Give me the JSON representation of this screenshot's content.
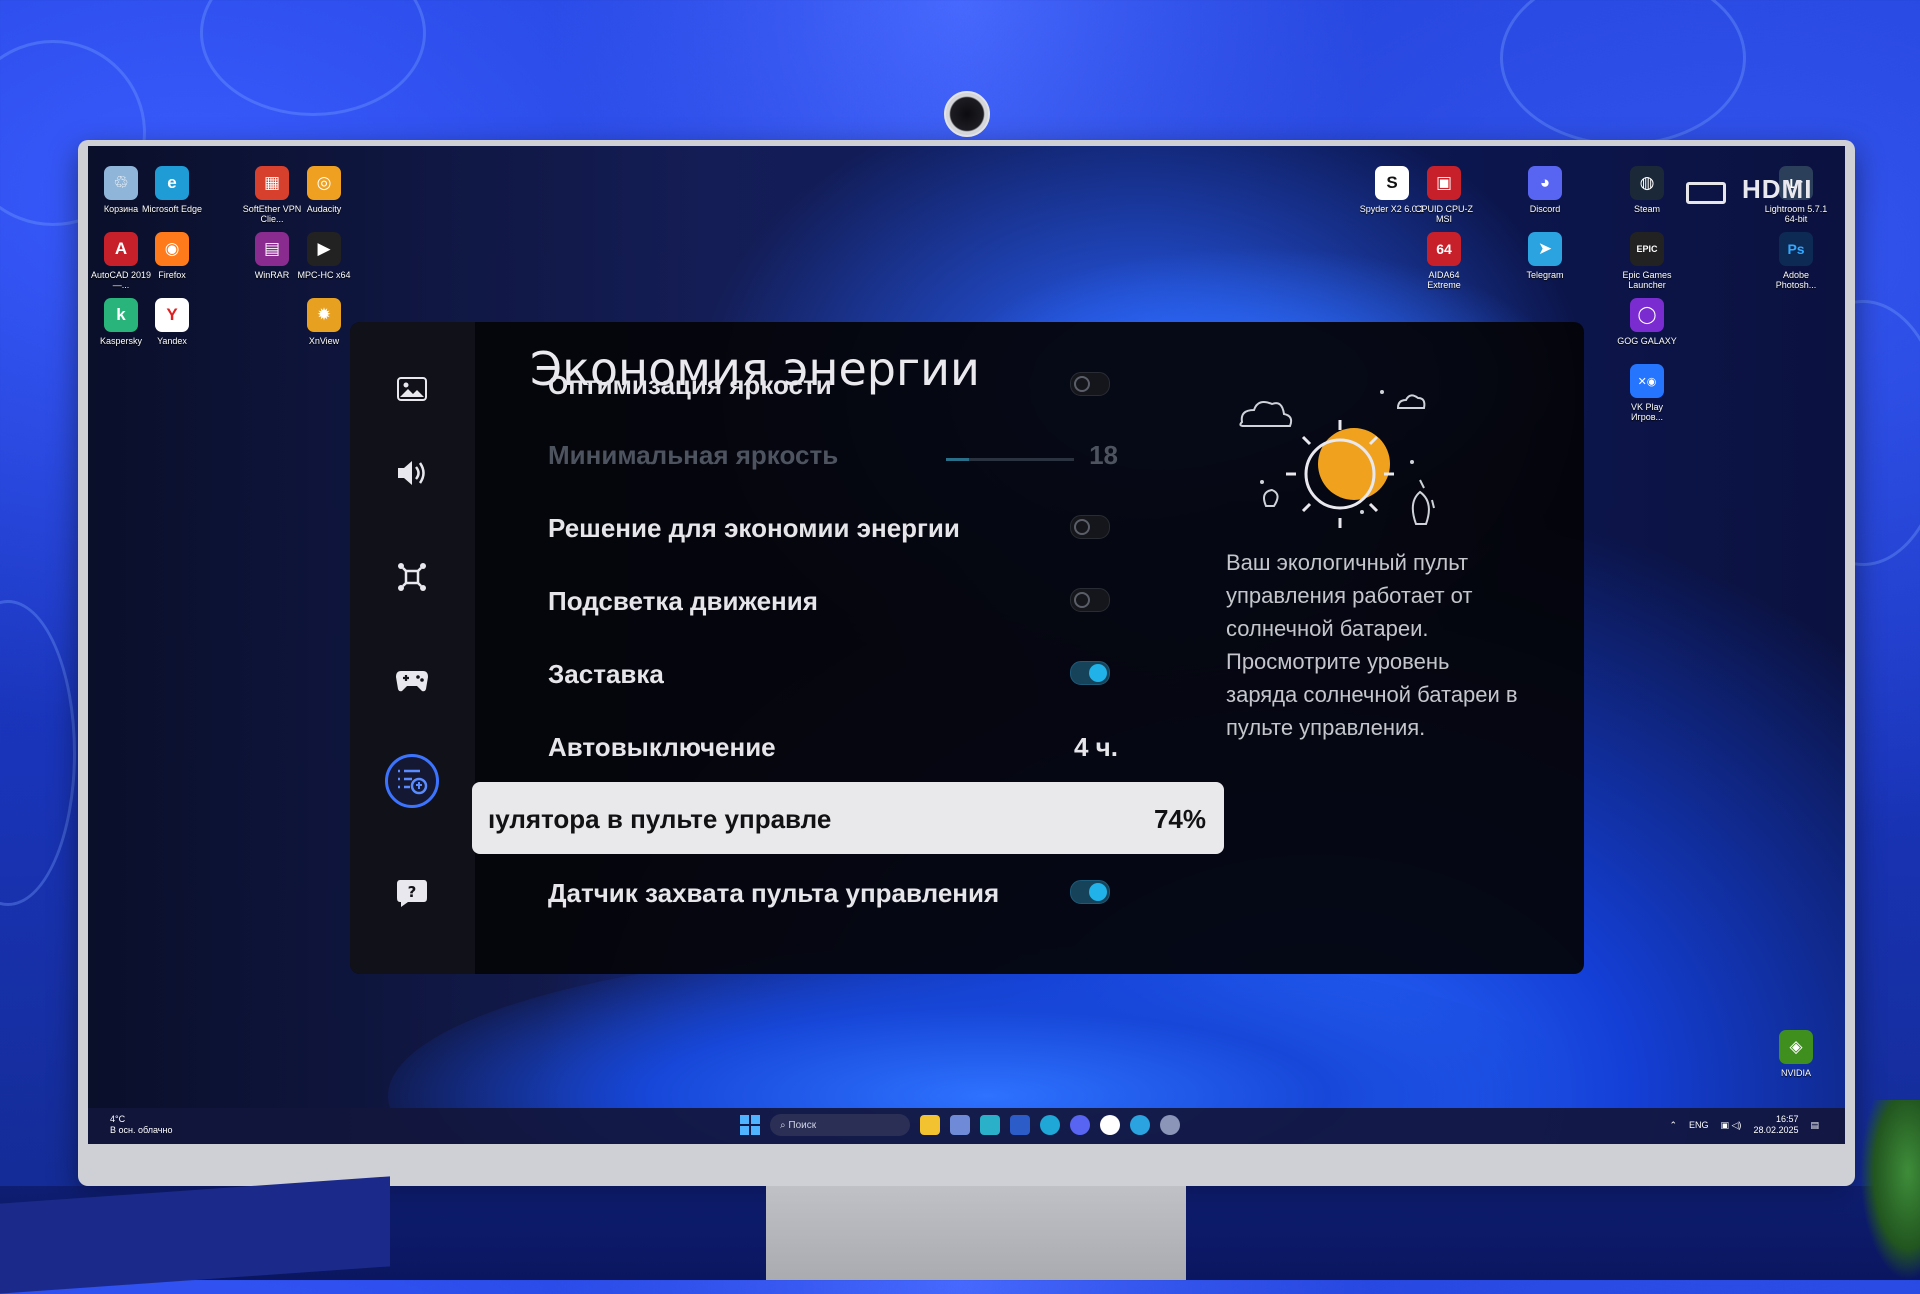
{
  "settings_menu": {
    "title": "Экономия энергии",
    "rows": [
      {
        "label": "Оптимизация яркости",
        "type": "toggle",
        "state": "off"
      },
      {
        "label": "Минимальная яркость",
        "type": "slider",
        "value": "18",
        "level": 0.18,
        "disabled": true
      },
      {
        "label": "Решение для экономии энергии",
        "type": "toggle",
        "state": "off"
      },
      {
        "label": "Подсветка движения",
        "type": "toggle",
        "state": "off"
      },
      {
        "label": "Заставка",
        "type": "toggle",
        "state": "on"
      },
      {
        "label": "Автовыключение",
        "type": "value",
        "value": "4 ч."
      },
      {
        "label": "ıулятора в пульте управле",
        "type": "value",
        "value": "74%",
        "selected": true
      },
      {
        "label": "Датчик захвата пульта управления",
        "type": "toggle",
        "state": "on"
      }
    ],
    "sidebar_icons": [
      "picture-icon",
      "sound-icon",
      "connection-icon",
      "game-icon",
      "general-icon",
      "support-icon"
    ],
    "active_sidebar": "general-icon",
    "info_text": "Ваш экологичный пульт управления работает от солнечной батареи. Просмотрите уровень заряда солнечной батареи в пульте управления."
  },
  "desktop_icons": [
    {
      "label": "Корзина",
      "color": "#8fb5d8",
      "glyph": "♲"
    },
    {
      "label": "Microsoft Edge",
      "color": "#1f9bd6",
      "glyph": "e"
    },
    {
      "label": "SoftEther VPN Clie...",
      "color": "#d6402c",
      "glyph": "▦"
    },
    {
      "label": "Audacity",
      "color": "#f0a020",
      "glyph": "◎"
    },
    {
      "label": "AutoCAD 2019 —...",
      "color": "#c8202a",
      "glyph": "A"
    },
    {
      "label": "Firefox",
      "color": "#ff7a1a",
      "glyph": "◉"
    },
    {
      "label": "WinRAR",
      "color": "#8a2b8f",
      "glyph": "▤"
    },
    {
      "label": "MPC-HC x64",
      "color": "#222",
      "glyph": "▶"
    },
    {
      "label": "Kaspersky",
      "color": "#28b47a",
      "glyph": "k"
    },
    {
      "label": "Yandex",
      "color": "#ffffff",
      "glyph": "Y"
    },
    {
      "label": "XnView",
      "color": "#e8a020",
      "glyph": "✹"
    },
    {
      "label": "Spyder X2 6.0.1",
      "color": "#ffffff",
      "glyph": "S"
    },
    {
      "label": "CPUID CPU-Z MSI",
      "color": "#c8202a",
      "glyph": "▣"
    },
    {
      "label": "Discord",
      "color": "#5865f2",
      "glyph": "◕"
    },
    {
      "label": "Steam",
      "color": "#1b2838",
      "glyph": "◍"
    },
    {
      "label": "Lightroom 5.7.1 64-bit",
      "color": "#2b3f5a",
      "glyph": "Lr"
    },
    {
      "label": "AIDA64 Extreme",
      "color": "#c8202a",
      "glyph": "64"
    },
    {
      "label": "Telegram",
      "color": "#2aa3e0",
      "glyph": "➤"
    },
    {
      "label": "Epic Games Launcher",
      "color": "#222",
      "glyph": "EPIC"
    },
    {
      "label": "Adobe Photosh...",
      "color": "#0d2a55",
      "glyph": "Ps"
    },
    {
      "label": "GOG GALAXY",
      "color": "#7a2cd0",
      "glyph": "◯"
    },
    {
      "label": "VK Play Игров...",
      "color": "#2575ff",
      "glyph": "✕◉"
    },
    {
      "label": "NVIDIA",
      "color": "#3f8f1f",
      "glyph": "◈"
    }
  ],
  "hdmi_label": "HDMI",
  "taskbar": {
    "weather_temp": "4°C",
    "weather_desc": "В осн. облачно",
    "search_placeholder": "Поиск",
    "lang": "ENG",
    "time": "16:57",
    "date": "28.02.2025"
  },
  "colors": {
    "accent": "#3c74ff",
    "toggle_on": "#20b2e8",
    "selected_row": "#e9e9ec"
  }
}
